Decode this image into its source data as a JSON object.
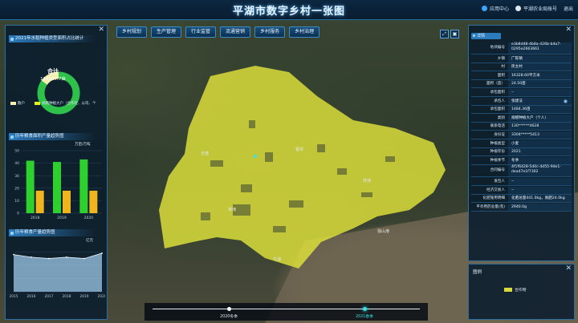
{
  "header": {
    "title": "平湖市数字乡村一张图",
    "app_center": "应用中心",
    "org": "平湖农业局账号",
    "logout": "退出"
  },
  "tabs": [
    "乡村规划",
    "生产管理",
    "行业监管",
    "流通营销",
    "乡村服务",
    "乡村治理"
  ],
  "left_panel": {
    "donut": {
      "title": "2021年水稻种植类型面积占比统计",
      "center_label": "合计",
      "center_value": "116937.7亩",
      "legend": [
        {
          "name": "散户",
          "color": "#f4efb0"
        },
        {
          "name": "规模种植大户（合作社、公司、个",
          "color": "#e7ef1d"
        }
      ],
      "chart_data": {
        "type": "pie",
        "segments": [
          {
            "name": "散户",
            "value": 0.15,
            "color": "#f4efb0"
          },
          {
            "name": "规模种植大户（合作社、公司、个",
            "value": 0.85,
            "color": "#2fc24a"
          }
        ]
      }
    },
    "bar": {
      "title": "历年粮食面积产量趋势图",
      "unit": "万亩/万吨",
      "chart_data": {
        "type": "bar",
        "categories": [
          "2018",
          "2019",
          "2020"
        ],
        "series": [
          {
            "values": [
              42,
              41,
              43
            ],
            "color": "#2ed02e"
          },
          {
            "values": [
              18,
              18,
              18
            ],
            "color": "#f0b41c"
          }
        ],
        "ylim": [
          0,
          50
        ],
        "yticks": [
          0,
          10,
          20,
          30,
          40,
          50
        ]
      }
    },
    "area": {
      "title": "历年粮食产量趋势图",
      "unit": "亿元",
      "chart_data": {
        "type": "area",
        "x": [
          "2015",
          "2016",
          "2017",
          "2018",
          "2019",
          "2020"
        ],
        "values": [
          28,
          26,
          25,
          26,
          25,
          29
        ],
        "ylim": [
          0,
          35
        ],
        "color": "#9ec9ea"
      }
    }
  },
  "right_panel": {
    "section_label": "详情",
    "rows": [
      {
        "k": "地块编号",
        "v": "e3b8d48-4b8a-426b-b4a7-0295e2663661"
      },
      {
        "k": "乡镇",
        "v": "广陈镇"
      },
      {
        "k": "村",
        "v": "民主村"
      },
      {
        "k": "面积",
        "v": "16328.60平方米"
      },
      {
        "k": "面积（亩）",
        "v": "24.50亩"
      },
      {
        "k": "承包面积",
        "v": "--"
      },
      {
        "k": "承包人",
        "v": "张建法"
      },
      {
        "k": "承包面积",
        "v": "1484.36亩"
      },
      {
        "k": "类别",
        "v": "规模种植大户（个人）"
      },
      {
        "k": "联系电话",
        "v": "130******4628"
      },
      {
        "k": "身份证",
        "v": "3304*****5413"
      },
      {
        "k": "种植类型",
        "v": "小麦"
      },
      {
        "k": "种植年份",
        "v": "2021"
      },
      {
        "k": "种植季节",
        "v": "冬季"
      },
      {
        "k": "合同编号",
        "v": "4f1f6428-5d0c-4d55-9de1-dea47e1f7302"
      },
      {
        "k": "发包人",
        "v": "--"
      },
      {
        "k": "经济交易人",
        "v": "--"
      },
      {
        "k": "化肥施用明细",
        "v": "化肥总量441.0kg，氮肥24.0kg"
      },
      {
        "k": "平亭用药总量(克)",
        "v": "2940.0g"
      }
    ]
  },
  "legend_panel": {
    "title": "图例",
    "items": [
      {
        "name": "合作物",
        "color": "#d8db3c"
      }
    ]
  },
  "timeline": {
    "labels": [
      "2020冬季",
      "2021春季"
    ],
    "active_index": 1
  },
  "map_labels": [
    "嘉善",
    "钟埭",
    "乍浦",
    "曹桥",
    "林埭",
    "独山港",
    "全塘",
    "新仓",
    "东湖"
  ]
}
